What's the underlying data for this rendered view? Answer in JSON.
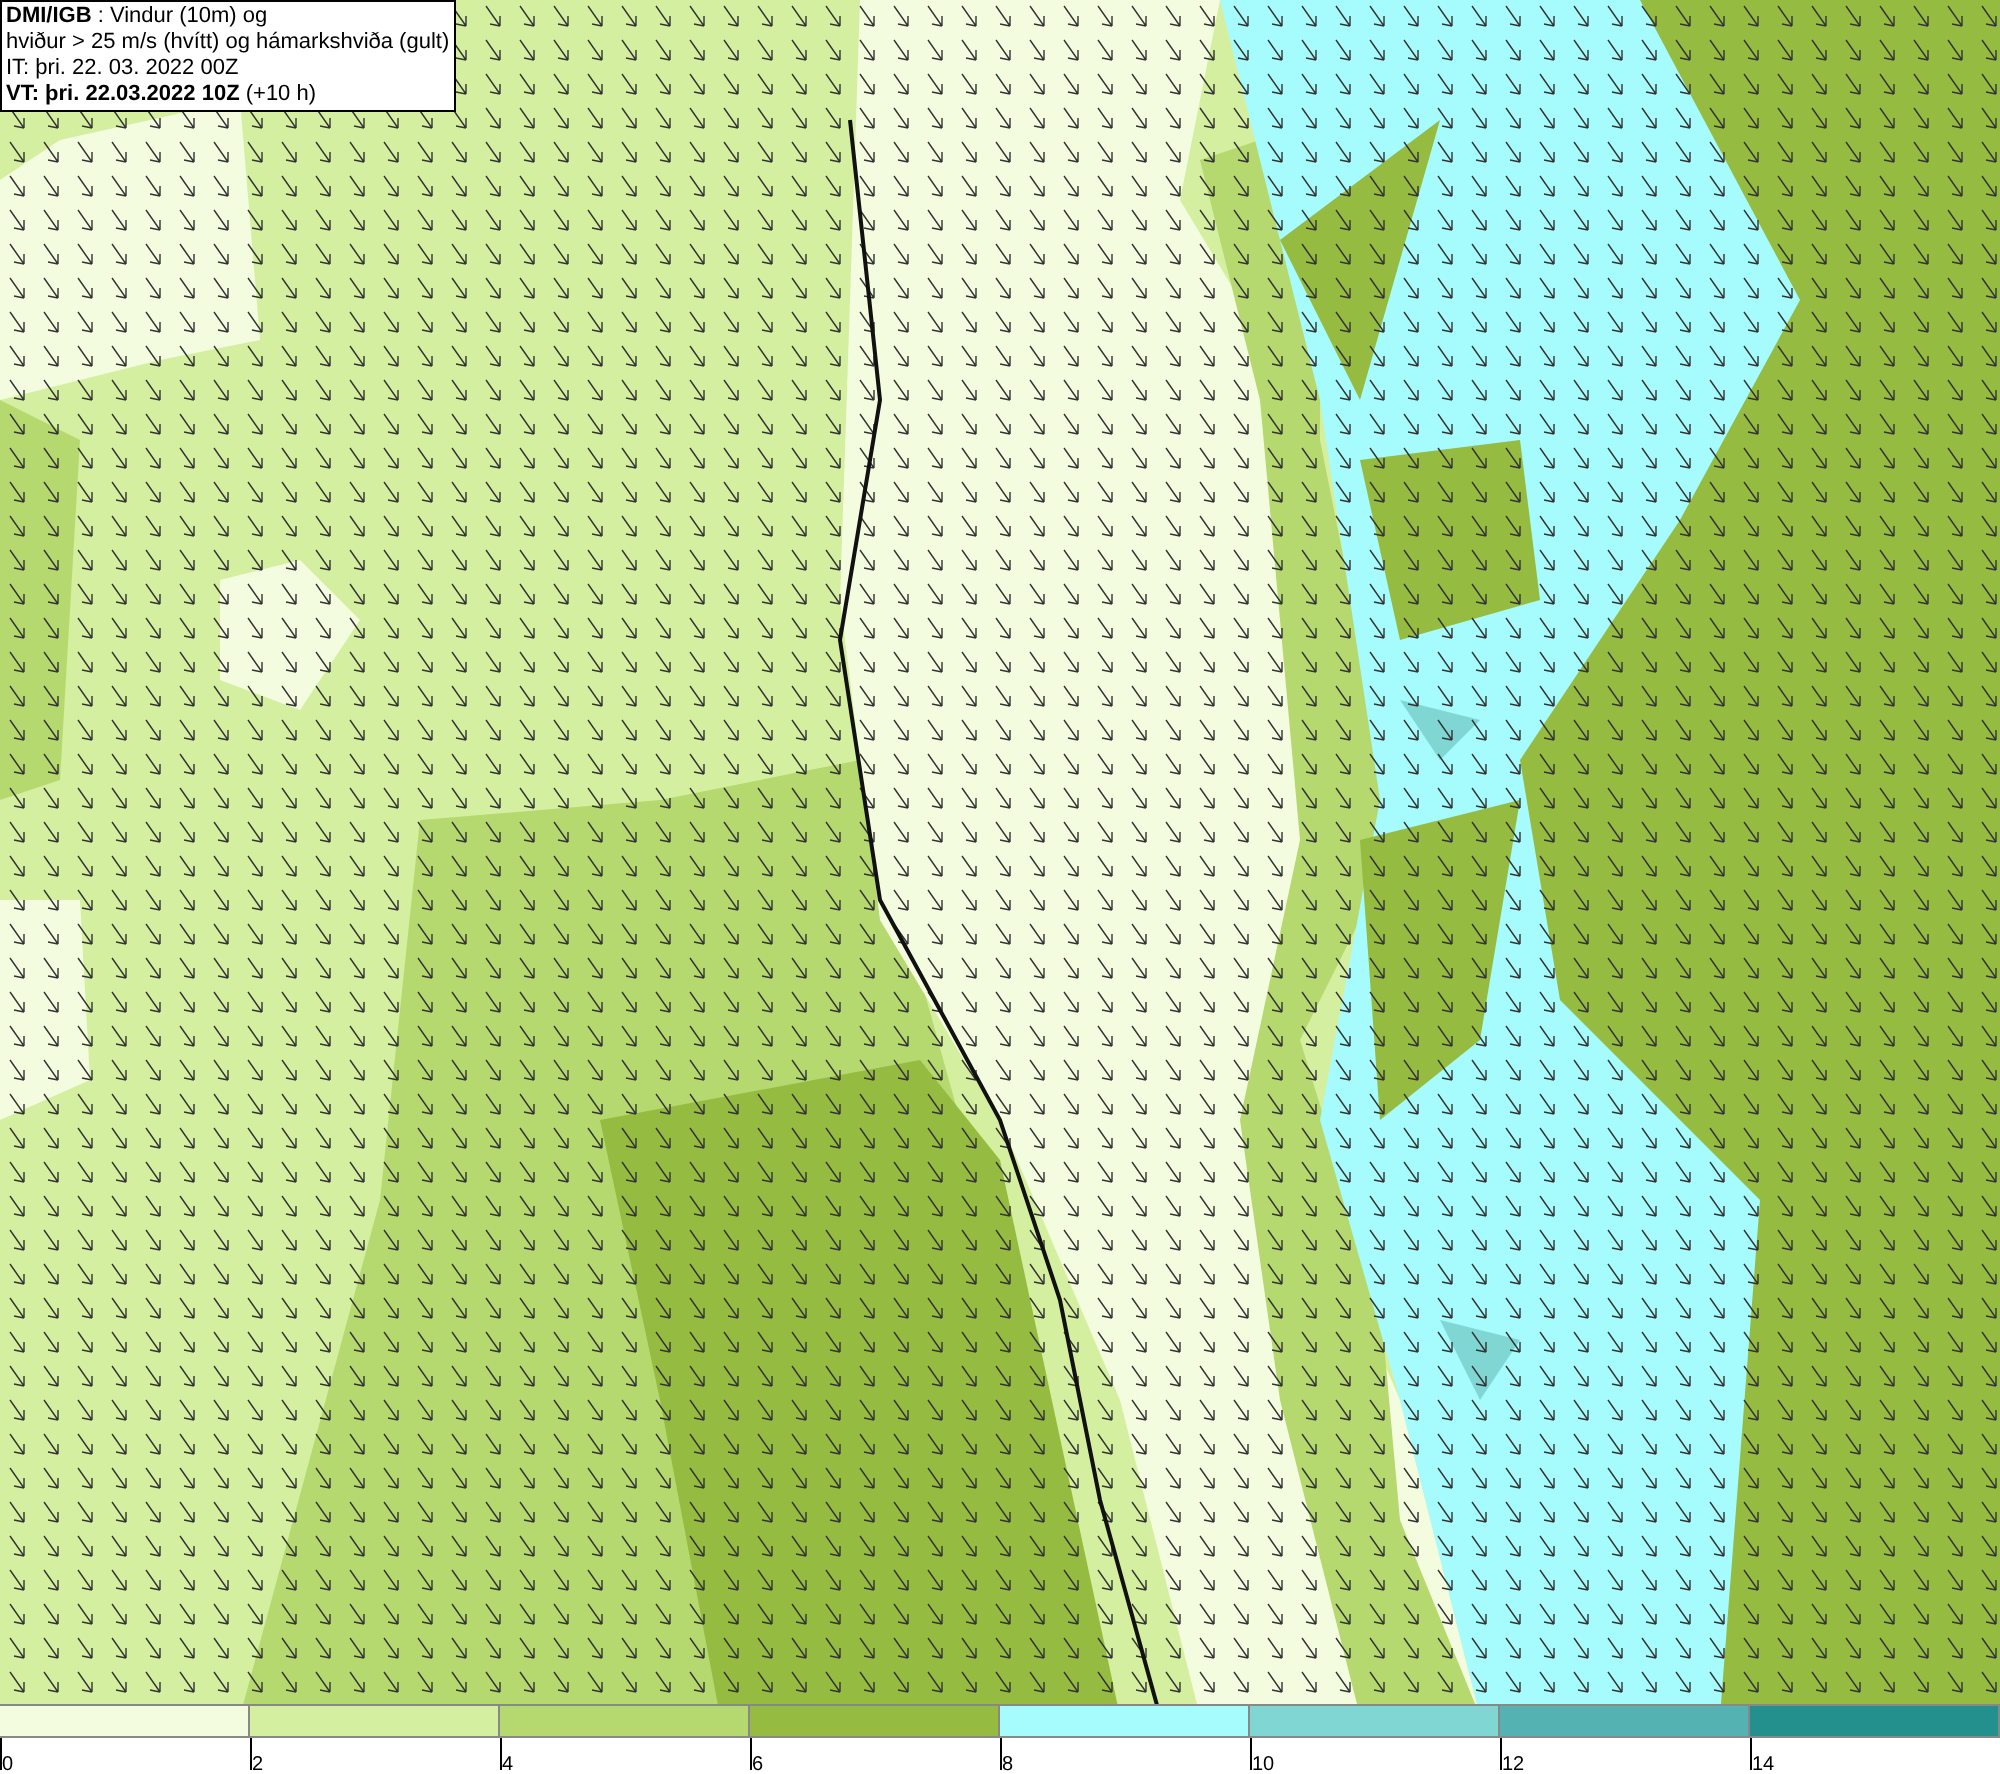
{
  "title_box": {
    "lines": [
      "**DMI/IGB** : Vindur (10m) og",
      "hviður > 25 m/s (hvítt) og hámarkshviða (gult)",
      "IT: þri. 22. 03. 2022 00Z",
      "**VT: þri. 22.03.2022 10Z** (+10 h)"
    ]
  },
  "legend": {
    "segments": [
      {
        "label": "0",
        "color": "#f4fce0"
      },
      {
        "label": "2",
        "color": "#d5efa0"
      },
      {
        "label": "4",
        "color": "#b5d96e"
      },
      {
        "label": "6",
        "color": "#95bb40"
      },
      {
        "label": "8",
        "color": "#a6fcfc"
      },
      {
        "label": "10",
        "color": "#7fd6d3"
      },
      {
        "label": "12",
        "color": "#54b2b3"
      },
      {
        "label": "14",
        "color": "#23908d"
      }
    ]
  }
}
